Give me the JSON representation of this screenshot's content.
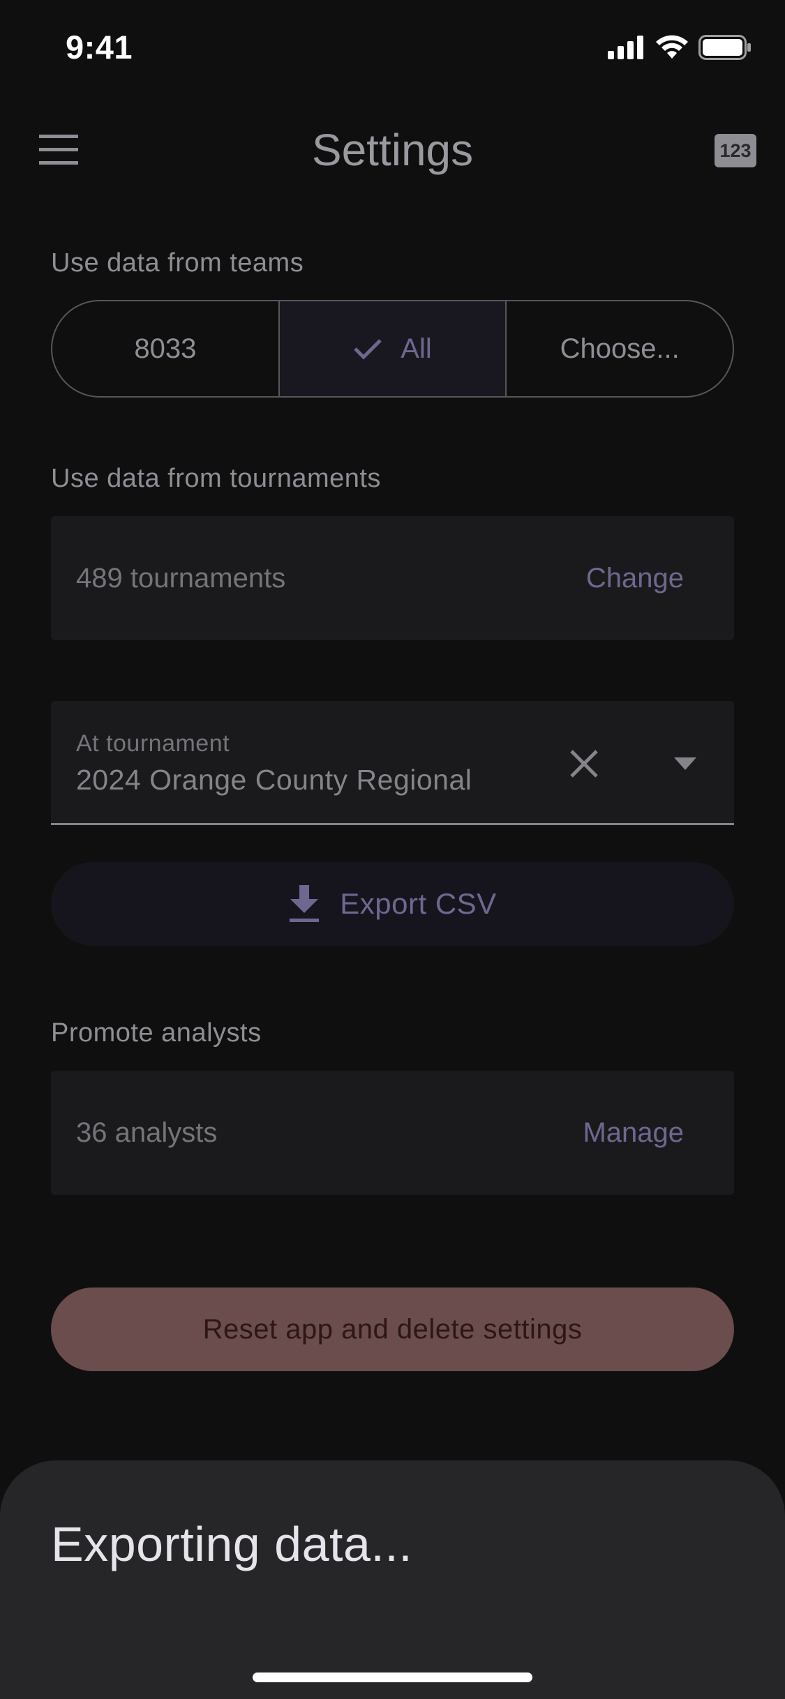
{
  "status_bar": {
    "time": "9:41",
    "icons": [
      "signal-icon",
      "wifi-icon",
      "battery-icon"
    ]
  },
  "app_bar": {
    "title": "Settings",
    "menu_icon": "menu-icon",
    "badge": "123"
  },
  "teams": {
    "label": "Use data from teams",
    "options": [
      "8033",
      "All",
      "Choose..."
    ],
    "selected": "All"
  },
  "tournaments": {
    "label": "Use data from tournaments",
    "count_text": "489 tournaments",
    "action": "Change"
  },
  "at_tournament": {
    "label": "At tournament",
    "value": "2024 Orange County Regional"
  },
  "export": {
    "label": "Export CSV"
  },
  "analysts": {
    "label": "Promote analysts",
    "count_text": "36 analysts",
    "action": "Manage"
  },
  "reset": {
    "label": "Reset app and delete settings"
  },
  "sheet": {
    "title": "Exporting data..."
  },
  "colors": {
    "background": "#0f0f10",
    "accent": "#6e6890",
    "danger": "#6a4d4c",
    "sheet": "#262528"
  }
}
